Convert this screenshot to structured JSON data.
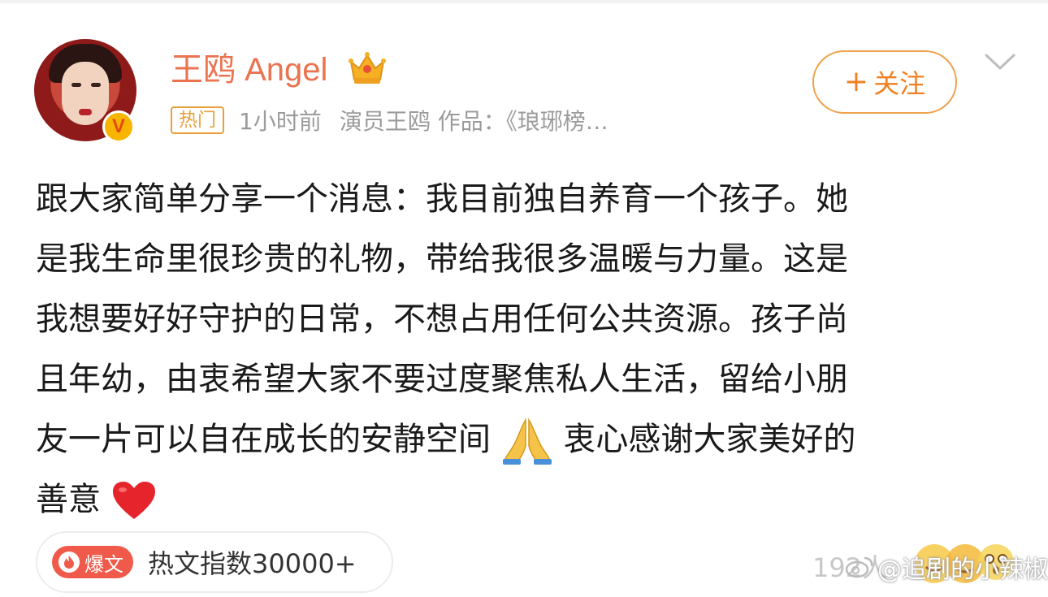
{
  "user": {
    "name": "王鸥 Angel",
    "verified_badge": "V",
    "crown_icon": "crown-icon"
  },
  "meta": {
    "tag": "热门",
    "time": "1小时前",
    "description": "演员王鸥 作品：《琅琊榜…"
  },
  "follow": {
    "plus": "+",
    "label": "关注"
  },
  "post": {
    "lines": [
      "跟大家简单分享一个消息：我目前独自养育一个孩子。她",
      "是我生命里很珍贵的礼物，带给我很多温暖与力量。这是",
      "我想要好好守护的日常，不想占用任何公共资源。孩子尚",
      "且年幼，由衷希望大家不要过度聚焦私人生活，留给小朋",
      "友一片可以自在成长的安静空间",
      "衷心感谢大家美好的",
      "善意"
    ],
    "emojis": [
      "praying-hands-emoji",
      "red-heart-emoji"
    ]
  },
  "footer": {
    "badge": "爆文",
    "hot_index_label": "热文指数30000+",
    "count": "192人",
    "watermark": "@追剧的小辣椒"
  },
  "colors": {
    "username": "#eb7350",
    "follow": "#f08020",
    "hot_tag": "#e8a13a",
    "badge_bg": "#f05a4a"
  }
}
